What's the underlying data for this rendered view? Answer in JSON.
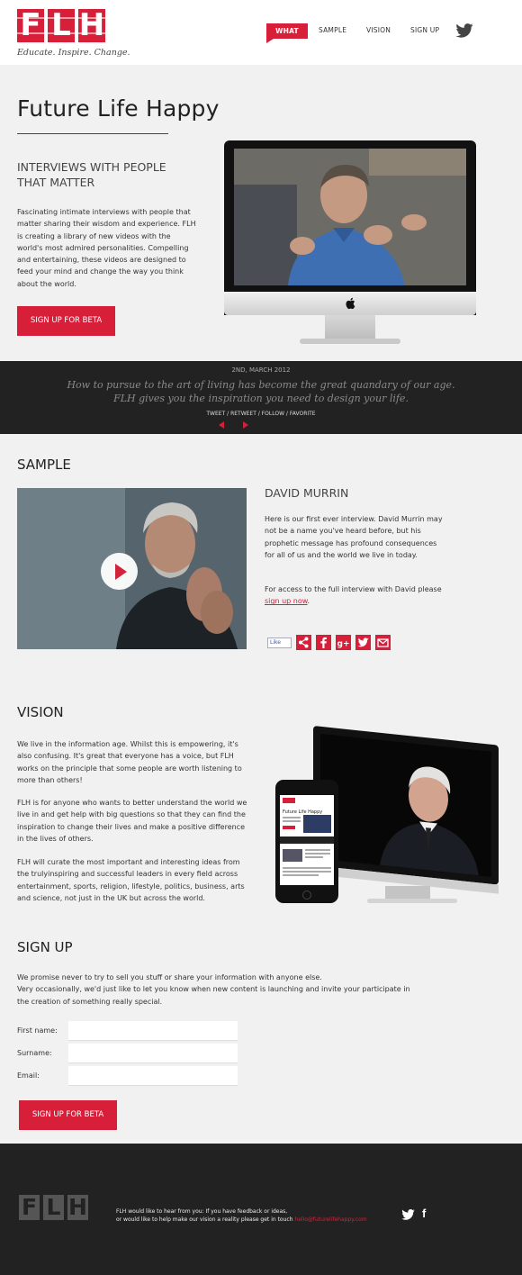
{
  "header": {
    "logo_letters": [
      "F",
      "L",
      "H"
    ],
    "tagline": "Educate. Inspire. Change.",
    "nav": {
      "what": "WHAT",
      "sample": "SAMPLE",
      "vision": "VISION",
      "signup": "SIGN UP"
    },
    "twitter_icon": "twitter-icon"
  },
  "hero": {
    "title": "Future Life Happy",
    "subtitle": "INTERVIEWS WITH PEOPLE THAT MATTER",
    "text": "Fascinating intimate interviews with people that matter sharing their wisdom and experience. FLH is creating a library of new videos with the world's most admired personalities. Compelling and entertaining, these videos are designed to feed your mind and change the way you think about the world.",
    "button": "SIGN UP FOR BETA"
  },
  "quote": {
    "date": "2ND, MARCH 2012",
    "line1": "How to pursue to the art of living has become the great quandary of our age.",
    "line2": "FLH gives you the inspiration you need to design your life.",
    "links": "TWEET / RETWEET / FOLLOW / FAVORITE"
  },
  "sample": {
    "heading": "SAMPLE",
    "name": "DAVID MURRIN",
    "text1": "Here is our first ever interview. David Murrin may not be a name you've heard before, but his prophetic message has profound consequences for all of us and the world we live in today.",
    "text2_pre": "For access to the full interview with David please ",
    "text2_link": "sign up now",
    "text2_post": ".",
    "like_label": "Like",
    "share_icons": [
      "share-icon",
      "facebook-icon",
      "googleplus-icon",
      "twitter-icon",
      "email-icon"
    ]
  },
  "vision": {
    "heading": "VISION",
    "p1": "We live in the information age. Whilst this is empowering, it's also confusing. It's great that everyone has a voice, but FLH works on the principle that some people are worth listening to more than others!",
    "p2": "FLH is for anyone who wants to better understand the world we live in and get help with big questions so that they can find the inspiration to change their lives and make a positive difference in the lives of others.",
    "p3": "FLH will curate the most important and interesting ideas from the trulyinspiring and successful leaders in every field across entertainment, sports, religion, lifestyle, politics, business, arts and science, not just in the UK but across the world.",
    "phone_title": "Future Life Happy"
  },
  "signup": {
    "heading": "SIGN UP",
    "text1": "We promise never to try to sell you stuff or share your information with anyone else.",
    "text2": "Very occasionally, we'd just like to let you know when new content is launching and invite your participate in the creation of something really special.",
    "first_name_label": "First name:",
    "surname_label": "Surname:",
    "email_label": "Email:",
    "first_name_value": "",
    "surname_value": "",
    "email_value": "",
    "button": "SIGN UP FOR BETA"
  },
  "footer": {
    "logo_letters": [
      "F",
      "L",
      "H"
    ],
    "line1": "FLH would like to hear from you: If you have feedback or ideas,",
    "line2": "or would like to help make our vision a reality please get in touch ",
    "email": "hello@futurelifehappy.com",
    "fb_letter": "f"
  },
  "colors": {
    "accent": "#d81f3a",
    "dark": "#222222",
    "background": "#f1f1f1"
  }
}
